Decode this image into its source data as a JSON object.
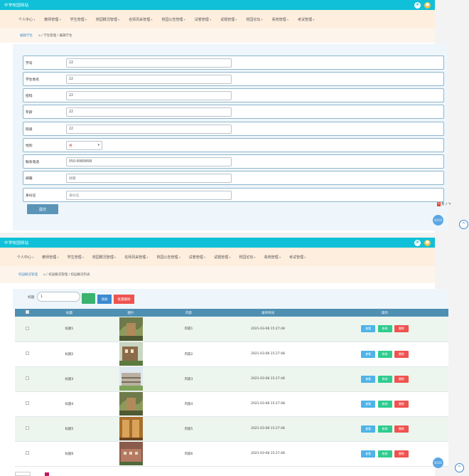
{
  "app_title": "中学校园网站",
  "nav": [
    "个人中心",
    "教师管理",
    "学生管理",
    "校园概况管理",
    "名师风采管理",
    "校园公告管理",
    "试卷管理",
    "试题管理",
    "校园论坛",
    "系统管理",
    "考试管理"
  ],
  "form_screen": {
    "crumb_current": "编辑学生",
    "crumb_path": "⌂ / 学生管理 / 编辑学生",
    "fields": [
      {
        "label": "学号",
        "value": "22"
      },
      {
        "label": "学生姓名",
        "value": "22"
      },
      {
        "label": "密码",
        "value": "22"
      },
      {
        "label": "年龄",
        "value": "22"
      },
      {
        "label": "班级",
        "value": "22"
      },
      {
        "label": "性别",
        "value": "男",
        "type": "select"
      },
      {
        "label": "联系电话",
        "value": "050-8989898"
      },
      {
        "label": "邮箱",
        "placeholder": "邮箱"
      },
      {
        "label": "身份证",
        "placeholder": "身份证"
      }
    ],
    "submit_label": "提交",
    "badge": "10:01"
  },
  "list_screen": {
    "crumb_current": "校园概况管理",
    "crumb_path": "⌂ / 校园概况管理 / 校园概况列表",
    "search_label": "标题",
    "search_value": "1",
    "add_label": "添加",
    "bulk_delete_label": "批量删除",
    "columns": [
      "标题",
      "图片",
      "内容",
      "发布时间",
      "操作"
    ],
    "rows": [
      {
        "title": "标题1",
        "content": "内容1",
        "time": "2021-03-08 15:27:48"
      },
      {
        "title": "标题2",
        "content": "内容2",
        "time": "2021-03-08 15:27:48"
      },
      {
        "title": "标题3",
        "content": "内容3",
        "time": "2021-03-08 15:27:48"
      },
      {
        "title": "标题4",
        "content": "内容4",
        "time": "2021-03-08 15:27:48"
      },
      {
        "title": "标题5",
        "content": "内容5",
        "time": "2021-03-08 15:27:48"
      },
      {
        "title": "标题6",
        "content": "内容6",
        "time": "2021-03-08 15:27:48"
      }
    ],
    "actions": {
      "view": "查看",
      "edit": "修改",
      "delete": "删除"
    },
    "badge": "10:01"
  },
  "colors": {
    "topbar": "#10c0d8",
    "nav_bg": "#fdeede",
    "header_row": "#4f8fb2",
    "accent_green": "#39b36e",
    "danger": "#ef5350"
  }
}
